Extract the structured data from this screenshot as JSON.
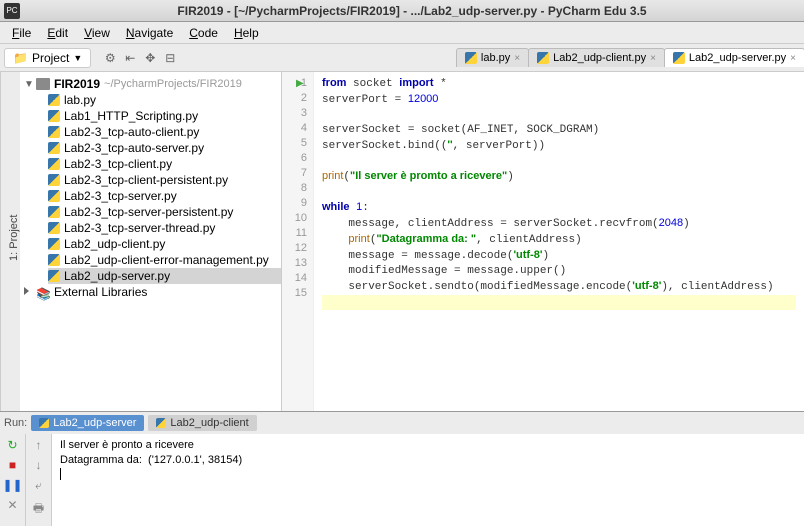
{
  "window": {
    "app_icon": "PC",
    "title": "FIR2019 - [~/PycharmProjects/FIR2019] - .../Lab2_udp-server.py - PyCharm Edu 3.5"
  },
  "menu": {
    "file": "File",
    "edit": "Edit",
    "view": "View",
    "navigate": "Navigate",
    "code": "Code",
    "help": "Help"
  },
  "project_label": "Project",
  "side_tab": "1: Project",
  "tabs": {
    "t1": "lab.py",
    "t2": "Lab2_udp-client.py",
    "t3": "Lab2_udp-server.py"
  },
  "tree": {
    "root": "FIR2019",
    "root_path": "~/PycharmProjects/FIR2019",
    "files": {
      "f1": "lab.py",
      "f2": "Lab1_HTTP_Scripting.py",
      "f3": "Lab2-3_tcp-auto-client.py",
      "f4": "Lab2-3_tcp-auto-server.py",
      "f5": "Lab2-3_tcp-client.py",
      "f6": "Lab2-3_tcp-client-persistent.py",
      "f7": "Lab2-3_tcp-server.py",
      "f8": "Lab2-3_tcp-server-persistent.py",
      "f9": "Lab2-3_tcp-server-thread.py",
      "f10": "Lab2_udp-client.py",
      "f11": "Lab2_udp-client-error-management.py",
      "f12": "Lab2_udp-server.py"
    },
    "external": "External Libraries"
  },
  "editor": {
    "lines": [
      "1",
      "2",
      "3",
      "4",
      "5",
      "6",
      "7",
      "8",
      "9",
      "10",
      "11",
      "12",
      "13",
      "14",
      "15"
    ]
  },
  "run": {
    "label": "Run:",
    "tab1": "Lab2_udp-server",
    "tab2": "Lab2_udp-client",
    "out_line1": "Il server è pronto a ricevere",
    "out_line2": "Datagramma da:  ('127.0.0.1', 38154)"
  },
  "chart_data": {
    "type": "table",
    "title": "Lab2_udp-server.py source code",
    "code_lines": [
      {
        "n": 1,
        "text": "from socket import *"
      },
      {
        "n": 2,
        "text": "serverPort = 12000"
      },
      {
        "n": 3,
        "text": ""
      },
      {
        "n": 4,
        "text": "serverSocket = socket(AF_INET, SOCK_DGRAM)"
      },
      {
        "n": 5,
        "text": "serverSocket.bind(('', serverPort))"
      },
      {
        "n": 6,
        "text": ""
      },
      {
        "n": 7,
        "text": "print(\"Il server è promto a ricevere\")"
      },
      {
        "n": 8,
        "text": ""
      },
      {
        "n": 9,
        "text": "while 1:"
      },
      {
        "n": 10,
        "text": "    message, clientAddress = serverSocket.recvfrom(2048)"
      },
      {
        "n": 11,
        "text": "    print(\"Datagramma da: \", clientAddress)"
      },
      {
        "n": 12,
        "text": "    message = message.decode('utf-8')"
      },
      {
        "n": 13,
        "text": "    modifiedMessage = message.upper()"
      },
      {
        "n": 14,
        "text": "    serverSocket.sendto(modifiedMessage.encode('utf-8'), clientAddress)"
      },
      {
        "n": 15,
        "text": ""
      }
    ]
  }
}
